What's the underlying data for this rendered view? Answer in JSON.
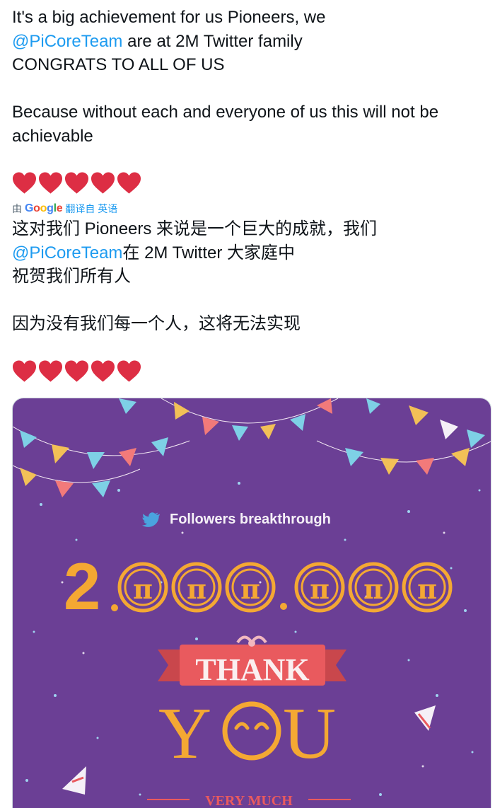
{
  "tweet": {
    "en_line1": "It's a big achievement for us Pioneers, we",
    "en_mention": "@PiCoreTeam",
    "en_line2_rest": " are at 2M Twitter family",
    "en_line3": "CONGRATS TO ALL OF US",
    "en_para2": "Because without each and everyone of us this will not be achievable",
    "hearts": "❤️❤️❤️❤️❤️"
  },
  "translation": {
    "prefix": "由",
    "provider": "Google",
    "link": "翻译自 英语"
  },
  "translated": {
    "line1": "这对我们 Pioneers 来说是一个巨大的成就，我们",
    "mention": "@PiCoreTeam",
    "line2_rest": "在 2M Twitter 大家庭中",
    "line3": "祝贺我们所有人",
    "para2": "因为没有我们每一个人，这将无法实现"
  },
  "media": {
    "headline": "Followers breakthrough",
    "digit": "2",
    "thank": "THANK",
    "you_y": "Y",
    "you_u": "U",
    "very_much": "VERY MUCH",
    "pi_symbol": "π",
    "colors": {
      "background": "#6b3f95",
      "gold": "#f4a833",
      "ribbon": "#e95a5e",
      "accent_white": "#f5f0f7"
    }
  }
}
